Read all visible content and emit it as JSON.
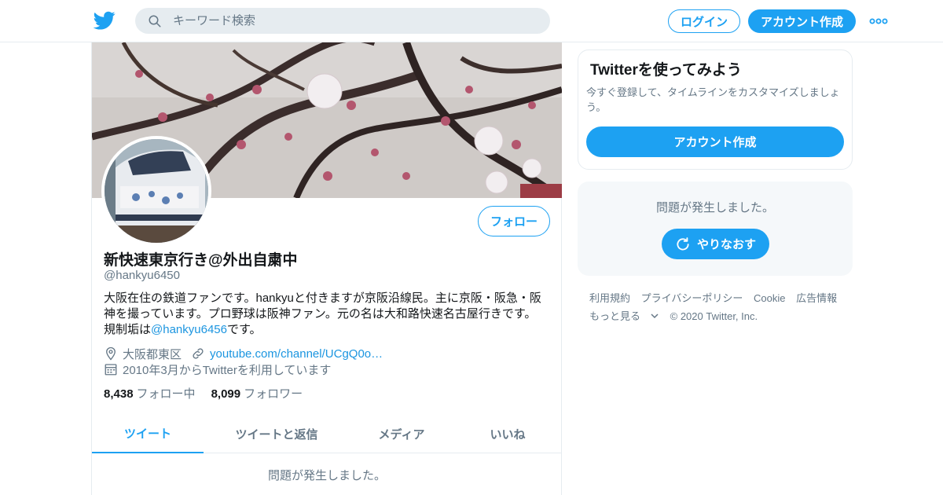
{
  "topbar": {
    "search_placeholder": "キーワード検索",
    "login_label": "ログイン",
    "signup_label": "アカウント作成"
  },
  "profile": {
    "display_name": "新快速東京行き@外出自粛中",
    "handle": "@hankyu6450",
    "bio_line1": "大阪在住の鉄道ファンです。hankyuと付きますが京阪沿線民。主に京阪・阪急・阪",
    "bio_line2": "神を撮っています。プロ野球は阪神ファン。元の名は大和路快速名古屋行きです。",
    "bio_line3_prefix": "規制垢は",
    "bio_mention": "@hankyu6456",
    "bio_line3_suffix": "です。",
    "location": "大阪都東区",
    "url": "youtube.com/channel/UCgQ0o…",
    "joined": "2010年3月からTwitterを利用しています",
    "following_count": "8,438",
    "following_label": "フォロー中",
    "followers_count": "8,099",
    "followers_label": "フォロワー",
    "follow_button": "フォロー"
  },
  "tabs": [
    {
      "label": "ツイート",
      "active": true
    },
    {
      "label": "ツイートと返信",
      "active": false
    },
    {
      "label": "メディア",
      "active": false
    },
    {
      "label": "いいね",
      "active": false
    }
  ],
  "main_error": "問題が発生しました。",
  "signup_card": {
    "title": "Twitterを使ってみよう",
    "subtitle": "今すぐ登録して、タイムラインをカスタマイズしましょう。",
    "button": "アカウント作成"
  },
  "sidebar_error": {
    "text": "問題が発生しました。",
    "retry": "やりなおす"
  },
  "footer": {
    "terms": "利用規約",
    "privacy": "プライバシーポリシー",
    "cookie": "Cookie",
    "ads": "広告情報",
    "more": "もっと見る",
    "copyright": "© 2020 Twitter, Inc."
  },
  "colors": {
    "accent": "#1da1f2",
    "link": "#1b95e0",
    "muted": "#657786",
    "border": "#e6ecf0"
  }
}
